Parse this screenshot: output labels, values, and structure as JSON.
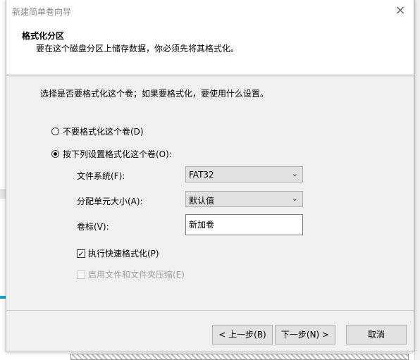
{
  "dialog": {
    "title": "新建简单卷向导",
    "close_glyph": "×"
  },
  "header": {
    "title": "格式化分区",
    "subtitle": "要在这个磁盘分区上储存数据，你必须先将其格式化。"
  },
  "prompt": "选择是否要格式化这个卷；如果要格式化，要使用什么设置。",
  "options": {
    "no_format": {
      "label": "不要格式化这个卷(D)",
      "selected": false
    },
    "format": {
      "label": "按下列设置格式化这个卷(O):",
      "selected": true
    }
  },
  "settings": {
    "file_system_label": "文件系统(F):",
    "file_system_value": "FAT32",
    "allocation_label": "分配单元大小(A):",
    "allocation_value": "默认值",
    "volume_label_label": "卷标(V):",
    "volume_label_value": "新加卷",
    "quick_format_label": "执行快速格式化(P)",
    "quick_format_checked": true,
    "compression_label": "启用文件和文件夹压缩(E)",
    "compression_checked": false,
    "compression_enabled": false
  },
  "buttons": {
    "back": "< 上一步(B)",
    "next": "下一步(N) >",
    "cancel": "取消"
  },
  "icons": {
    "dropdown": "chevron-down-icon",
    "check": "checkmark-icon",
    "close": "close-icon"
  },
  "colors": {
    "dialog_bg": "#f0f0f0",
    "header_bg": "#ffffff",
    "button_bg": "#e1e1e1",
    "disabled_text": "#a0a0a0"
  }
}
